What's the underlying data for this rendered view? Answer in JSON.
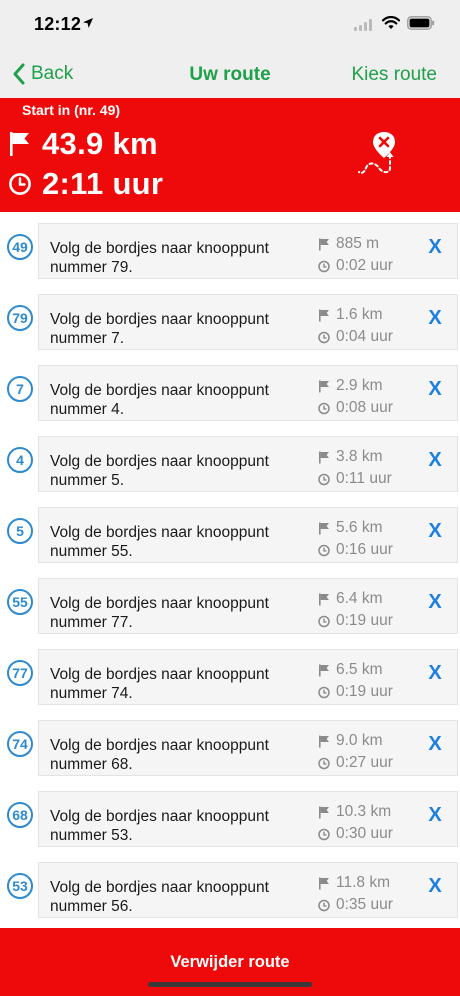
{
  "status": {
    "time": "12:12"
  },
  "nav": {
    "back": "Back",
    "title": "Uw route",
    "right": "Kies route"
  },
  "summary": {
    "start": "Start in  (nr. 49)",
    "distance": "43.9 km",
    "duration": "2:11 uur"
  },
  "colors": {
    "accent_green": "#1fa04a",
    "header_red": "#ee0a0a",
    "node_blue": "#2d8ad1",
    "remove_blue": "#1d7fe0"
  },
  "items": [
    {
      "node": "49",
      "line1": "Volg de bordjes naar knooppunt",
      "line2": "nummer 79.",
      "distance": "885 m",
      "time": "0:02 uur",
      "remove": "X"
    },
    {
      "node": "79",
      "line1": "Volg de bordjes naar knooppunt",
      "line2": "nummer 7.",
      "distance": "1.6 km",
      "time": "0:04 uur",
      "remove": "X"
    },
    {
      "node": "7",
      "line1": "Volg de bordjes naar knooppunt",
      "line2": "nummer 4.",
      "distance": "2.9 km",
      "time": "0:08 uur",
      "remove": "X"
    },
    {
      "node": "4",
      "line1": "Volg de bordjes naar knooppunt",
      "line2": "nummer 5.",
      "distance": "3.8 km",
      "time": "0:11 uur",
      "remove": "X"
    },
    {
      "node": "5",
      "line1": "Volg de bordjes naar knooppunt",
      "line2": "nummer 55.",
      "distance": "5.6 km",
      "time": "0:16 uur",
      "remove": "X"
    },
    {
      "node": "55",
      "line1": "Volg de bordjes naar knooppunt",
      "line2": "nummer 77.",
      "distance": "6.4 km",
      "time": "0:19 uur",
      "remove": "X"
    },
    {
      "node": "77",
      "line1": "Volg de bordjes naar knooppunt",
      "line2": "nummer 74.",
      "distance": "6.5 km",
      "time": "0:19 uur",
      "remove": "X"
    },
    {
      "node": "74",
      "line1": "Volg de bordjes naar knooppunt",
      "line2": "nummer 68.",
      "distance": "9.0 km",
      "time": "0:27 uur",
      "remove": "X"
    },
    {
      "node": "68",
      "line1": "Volg de bordjes naar knooppunt",
      "line2": "nummer 53.",
      "distance": "10.3 km",
      "time": "0:30 uur",
      "remove": "X"
    },
    {
      "node": "53",
      "line1": "Volg de bordjes naar knooppunt",
      "line2": "nummer 56.",
      "distance": "11.8 km",
      "time": "0:35 uur",
      "remove": "X"
    }
  ],
  "footer": {
    "button": "Verwijder route"
  }
}
